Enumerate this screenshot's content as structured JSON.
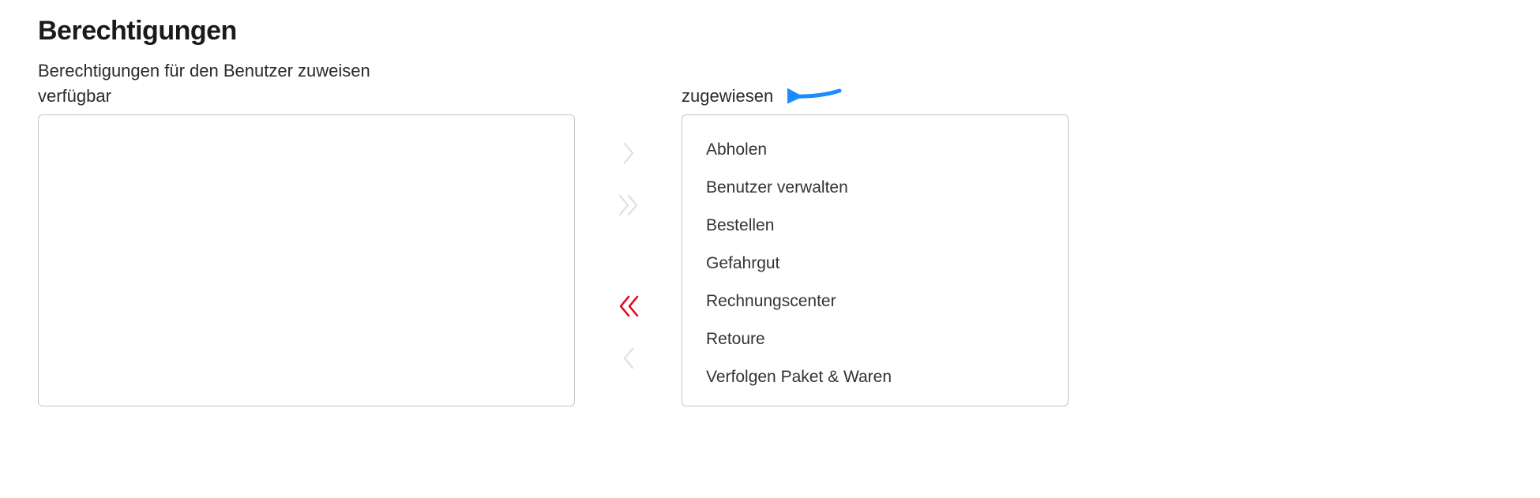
{
  "heading": "Berechtigungen",
  "description": "Berechtigungen für den Benutzer zuweisen",
  "available_label": "verfügbar",
  "assigned_label": "zugewiesen",
  "available_items": [],
  "assigned_items": [
    "Abholen",
    "Benutzer verwalten",
    "Bestellen",
    "Gefahrgut",
    "Rechnungscenter",
    "Retoure",
    "Verfolgen Paket & Waren"
  ],
  "controls": {
    "assign_one": "chevron-right",
    "assign_all": "chevron-double-right",
    "unassign_all": "chevron-double-left",
    "unassign_one": "chevron-left"
  },
  "annotation": {
    "arrow_points_to": "assigned_label",
    "color": "#1a8cff"
  }
}
